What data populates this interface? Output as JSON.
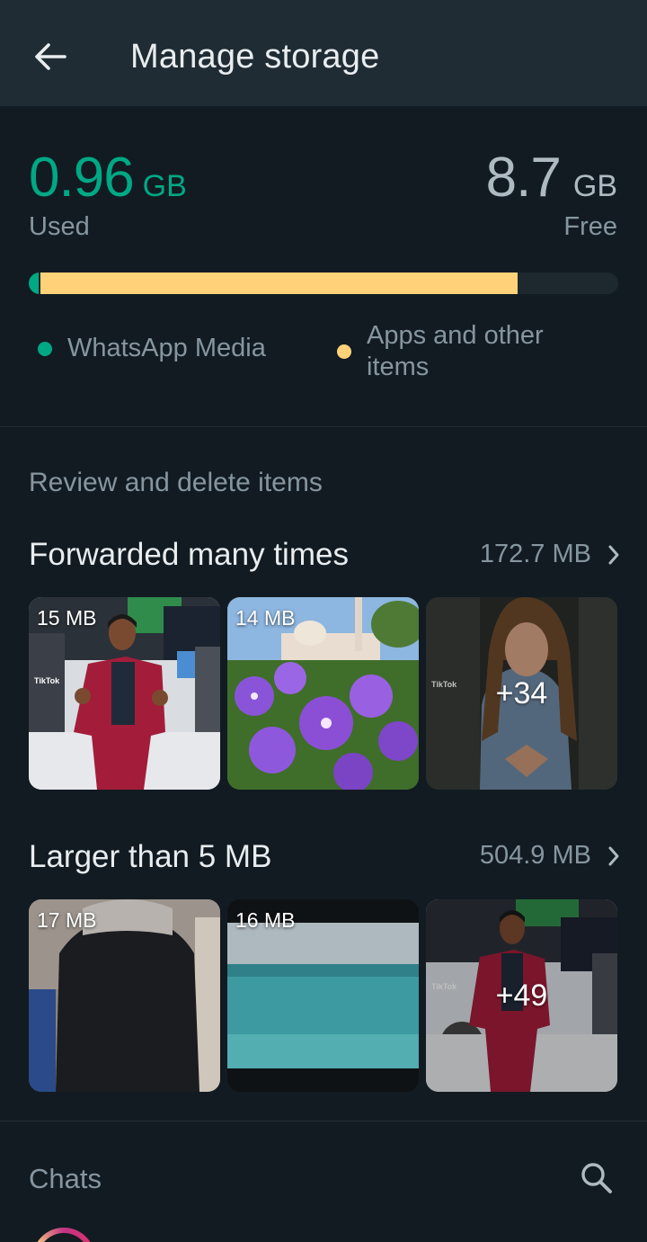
{
  "header": {
    "title": "Manage storage",
    "back_icon": "arrow-left-icon"
  },
  "storage": {
    "used_value": "0.96",
    "used_unit": "GB",
    "used_label": "Used",
    "free_value": "8.7",
    "free_unit": "GB",
    "free_label": "Free",
    "media_fraction": 0.017,
    "apps_fraction": 0.81,
    "legend": {
      "media": "WhatsApp Media",
      "apps": "Apps and other items"
    },
    "colors": {
      "media": "#00a884",
      "apps": "#ffd279",
      "track": "#1d282f"
    }
  },
  "review": {
    "section_label": "Review and delete items",
    "groups": [
      {
        "title": "Forwarded many times",
        "size": "172.7 MB",
        "thumbs": [
          {
            "size": "15 MB"
          },
          {
            "size": "14 MB"
          },
          {
            "more": "+34"
          }
        ]
      },
      {
        "title": "Larger than 5 MB",
        "size": "504.9 MB",
        "thumbs": [
          {
            "size": "17 MB"
          },
          {
            "size": "16 MB"
          },
          {
            "more": "+49"
          }
        ]
      }
    ]
  },
  "chats": {
    "label": "Chats",
    "search_icon": "search-icon"
  },
  "thumb_watermark": "TikTok"
}
